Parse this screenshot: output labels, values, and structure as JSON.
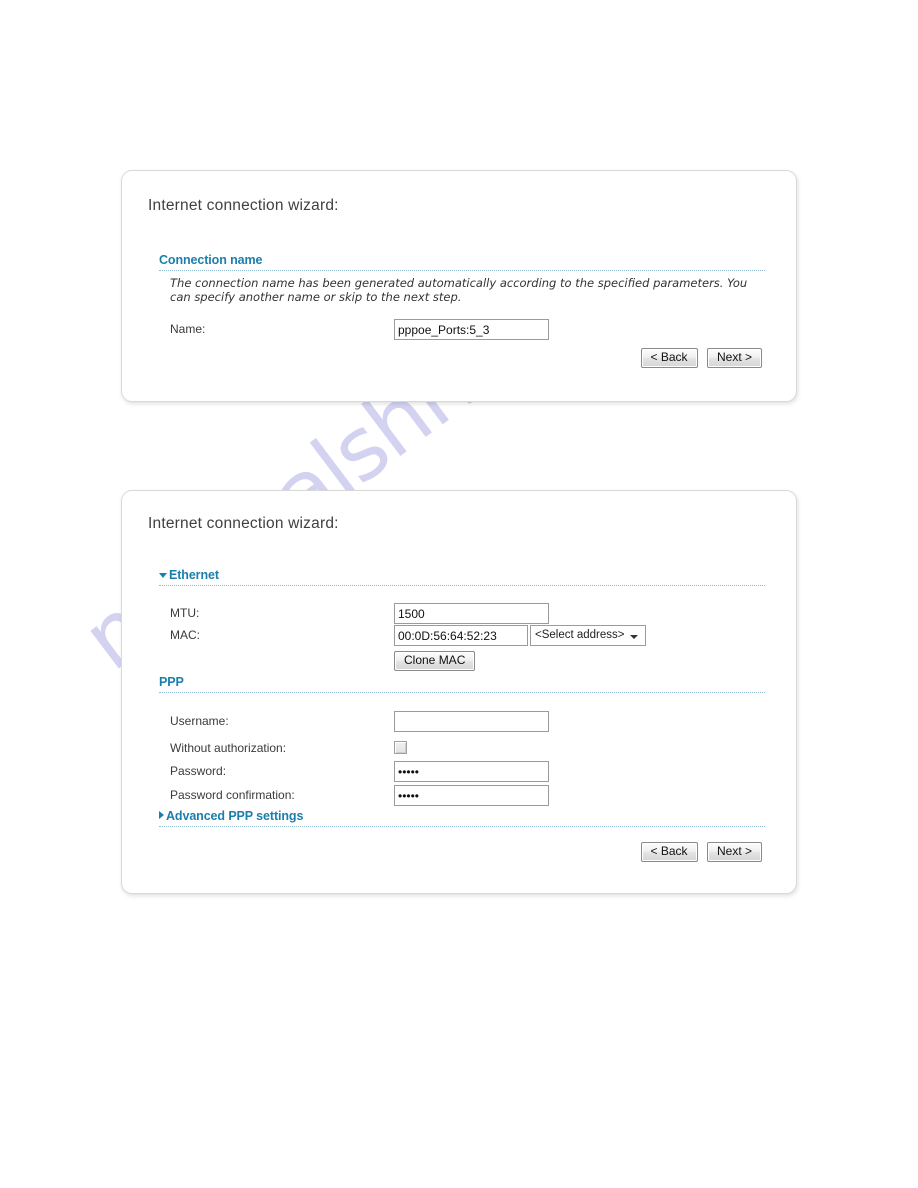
{
  "watermark": {
    "text": "manualshive.com",
    "color": "#b9b9ea"
  },
  "theme": {
    "heading_color": "#1b7fad",
    "text_color": "#3a3a3a",
    "panel_border": "#d9d9d9"
  },
  "panel_connection_name": {
    "title": "Internet connection wizard:",
    "section": {
      "label": "Connection name"
    },
    "hint": "The connection name has been generated automatically according to the specified parameters. You can specify another name or skip to the next step.",
    "fields": {
      "name": {
        "label": "Name:",
        "value": "pppoe_Ports:5_3",
        "placeholder": ""
      }
    },
    "buttons": {
      "back": "< Back",
      "next": "Next >"
    }
  },
  "panel_ethernet_ppp": {
    "title": "Internet connection wizard:",
    "ethernet_section": {
      "label": "Ethernet",
      "expanded": true
    },
    "ppp_section": {
      "label": "PPP",
      "expanded": true
    },
    "advanced_section": {
      "label": "Advanced PPP settings",
      "expanded": false
    },
    "fields": {
      "mtu": {
        "label": "MTU:",
        "value": "1500",
        "placeholder": ""
      },
      "mac": {
        "label": "MAC:",
        "value": "00:0D:56:64:52:23",
        "placeholder": ""
      },
      "mac_select": {
        "value": "<Select address>"
      },
      "clone_mac": {
        "label": "Clone MAC"
      },
      "username": {
        "label": "Username:",
        "value": "",
        "placeholder": ""
      },
      "without_authorization": {
        "label": "Without authorization:",
        "checked": false
      },
      "password": {
        "label": "Password:",
        "value": "•••••",
        "placeholder": ""
      },
      "password_confirmation": {
        "label": "Password confirmation:",
        "value": "•••••",
        "placeholder": ""
      }
    },
    "buttons": {
      "back": "< Back",
      "next": "Next >"
    }
  }
}
